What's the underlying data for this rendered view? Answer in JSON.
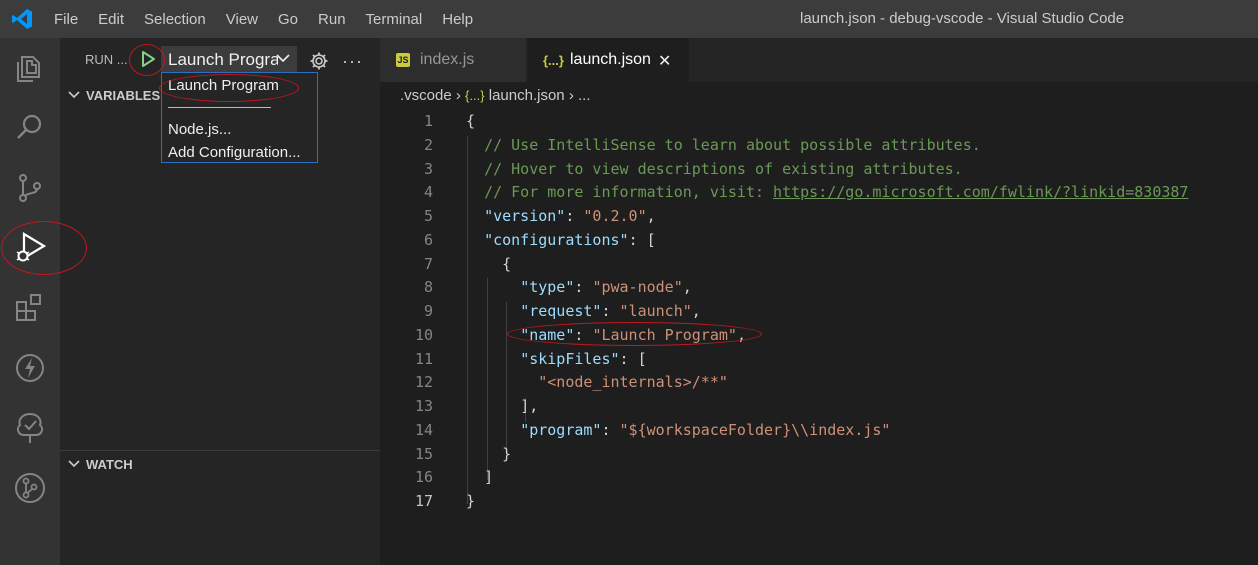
{
  "title_bar": {
    "menu": [
      "File",
      "Edit",
      "Selection",
      "View",
      "Go",
      "Run",
      "Terminal",
      "Help"
    ],
    "window_title": "launch.json - debug-vscode - Visual Studio Code"
  },
  "activity_bar": {
    "icons": [
      "explorer-icon",
      "search-icon",
      "source-control-icon",
      "run-debug-icon",
      "extensions-icon",
      "lightning-icon",
      "tree-icon",
      "git-graph-icon"
    ]
  },
  "sidebar": {
    "run_label": "RUN ...",
    "config_selected": "Launch Program",
    "more": "···",
    "variables_label": "VARIABLES",
    "watch_label": "WATCH",
    "dropdown": {
      "items": [
        "Launch Program",
        "Node.js...",
        "Add Configuration..."
      ]
    }
  },
  "editor": {
    "tabs": [
      {
        "icon": "JS",
        "label": "index.js"
      },
      {
        "icon": "{...}",
        "label": "launch.json",
        "close": "✕"
      }
    ],
    "breadcrumb": {
      "folder": ".vscode",
      "sep": "›",
      "file_icon": "{...}",
      "file": "launch.json",
      "tail": "..."
    },
    "line_numbers": [
      "1",
      "2",
      "3",
      "4",
      "5",
      "6",
      "7",
      "8",
      "9",
      "10",
      "11",
      "12",
      "13",
      "14",
      "15",
      "16",
      "17"
    ],
    "code": {
      "l1": "{",
      "l2": "// Use IntelliSense to learn about possible attributes.",
      "l3": "// Hover to view descriptions of existing attributes.",
      "l4_prefix": "// For more information, visit: ",
      "l4_link": "https://go.microsoft.com/fwlink/?linkid=830387",
      "l5_key": "\"version\"",
      "l5_val": "\"0.2.0\"",
      "l6_key": "\"configurations\"",
      "l6_rest": ": [",
      "l7": "{",
      "l8_key": "\"type\"",
      "l8_val": "\"pwa-node\"",
      "l9_key": "\"request\"",
      "l9_val": "\"launch\"",
      "l10_key": "\"name\"",
      "l10_val": "\"Launch Program\"",
      "l11_key": "\"skipFiles\"",
      "l11_rest": ": [",
      "l12_val": "\"<node_internals>/**\"",
      "l13": "],",
      "l14_key": "\"program\"",
      "l14_val": "\"${workspaceFolder}\\\\index.js\"",
      "l15": "}",
      "l16": "]",
      "l17": "}"
    }
  },
  "colors": {
    "accent_annotation": "#c0181e",
    "play_green": "#89d185",
    "comment": "#6a9955",
    "key": "#9cdcfe",
    "string": "#ce9178"
  }
}
